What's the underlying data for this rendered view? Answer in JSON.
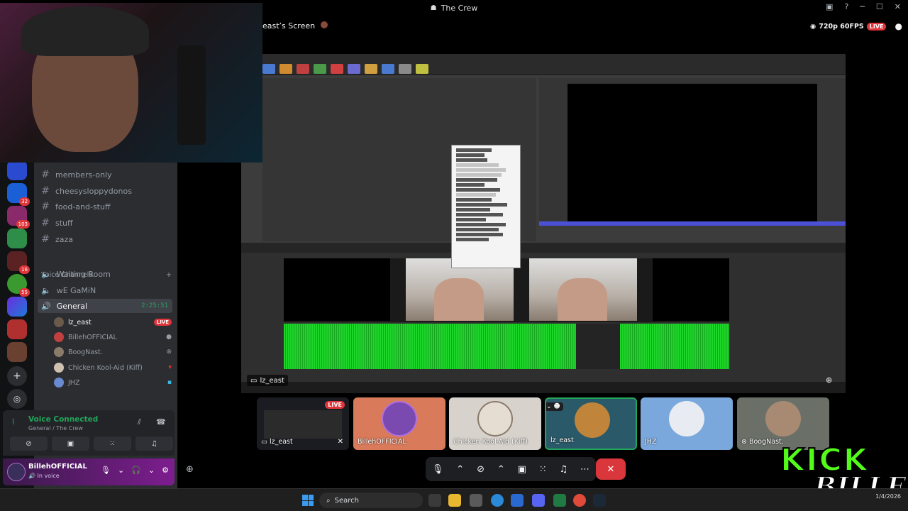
{
  "window": {
    "title": "The Crew"
  },
  "stream": {
    "title": "east’s Screen",
    "quality": "720p 60FPS",
    "live_label": "LIVE",
    "overlay_name": "lz_east"
  },
  "servers": {
    "badges": [
      "32",
      "103",
      "16",
      "55"
    ]
  },
  "channels": {
    "text": [
      {
        "name": "members-only"
      },
      {
        "name": "cheesysloppydonos"
      },
      {
        "name": "food-and-stuff"
      },
      {
        "name": "stuff"
      },
      {
        "name": "zaza"
      }
    ],
    "voice_header": "Voice Channels",
    "voice": [
      {
        "name": "Waiting Room"
      },
      {
        "name": "wE GaMiN"
      },
      {
        "name": "General",
        "timer": "2:25:51"
      }
    ],
    "voice_users": [
      {
        "name": "lz_east",
        "badge": "LIVE"
      },
      {
        "name": "BillehOFFICIAL"
      },
      {
        "name": "BoogNast."
      },
      {
        "name": "Chicken Kool-Aid (Kiff)"
      },
      {
        "name": "JHZ"
      }
    ]
  },
  "voice_panel": {
    "status": "Voice Connected",
    "location": "General / The Crew"
  },
  "user_panel": {
    "name": "BillehOFFICIAL",
    "status": "In voice"
  },
  "tiles": [
    {
      "name": "lz_east",
      "live": "LIVE"
    },
    {
      "name": "BillehOFFICIAL"
    },
    {
      "name": "Chicken Kool-Aid (Kiff)"
    },
    {
      "name": "lz_east"
    },
    {
      "name": "JHZ"
    },
    {
      "name": "BoogNast."
    }
  ],
  "kick": {
    "brand": "KICK",
    "handle": "BILLEH"
  },
  "taskbar": {
    "search_label": "Search",
    "date": "1/4/2026"
  },
  "colors": {
    "accent_green": "#23a55a",
    "live_red": "#e0363b",
    "kick_green": "#53fc18",
    "hangup_red": "#da373c"
  },
  "icons": [
    "search-icon",
    "mic-icon",
    "headphones-icon",
    "gear-icon",
    "screen-share-icon",
    "hang-up-icon",
    "add-person-icon",
    "zoom-icon",
    "hash-icon",
    "speaker-icon"
  ]
}
